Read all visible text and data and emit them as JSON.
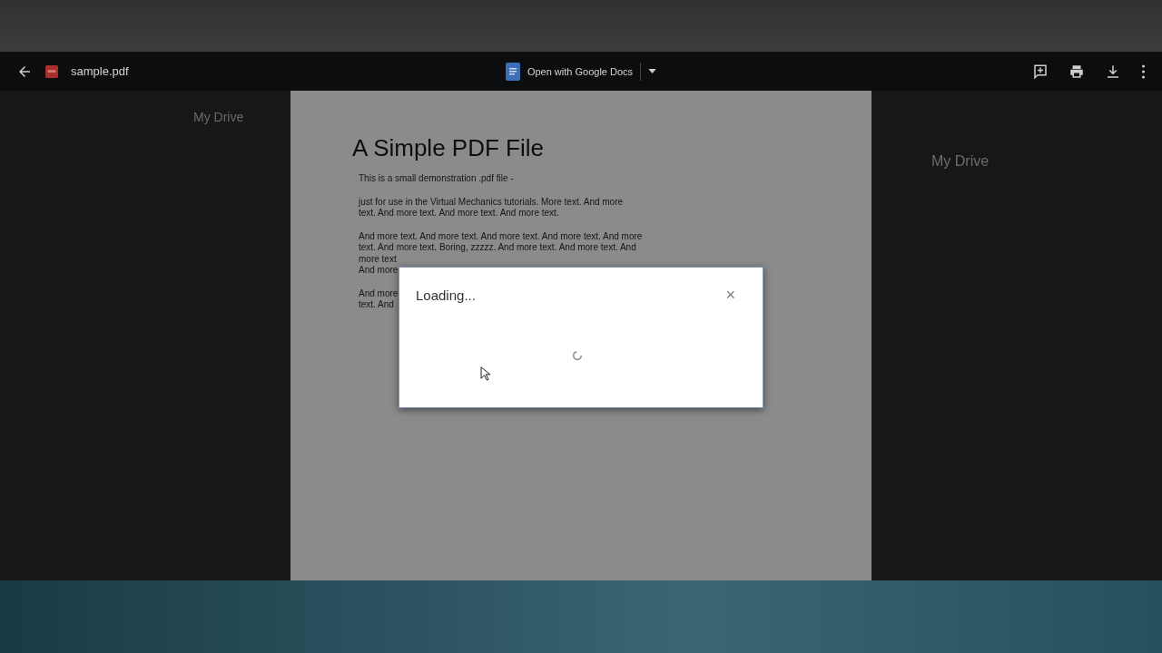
{
  "toolbar": {
    "file_name": "sample.pdf",
    "open_with": "Open with Google Docs"
  },
  "background": {
    "left_title": "My Drive",
    "right_title": "My Drive"
  },
  "document": {
    "title": "A Simple PDF File",
    "paragraphs": [
      [
        "This is a small demonstration .pdf file -"
      ],
      [
        "just for use in the Virtual Mechanics tutorials. More text. And more",
        "text. And more text. And more text. And more text."
      ],
      [
        "And more text. And more text. And more text. And more text. And more",
        "text. And more text. Boring, zzzzz. And more text. And more text. And",
        "more text",
        "And more"
      ],
      [
        "And more",
        "text. And"
      ]
    ]
  },
  "dialog": {
    "title": "Loading...",
    "close": "×"
  }
}
